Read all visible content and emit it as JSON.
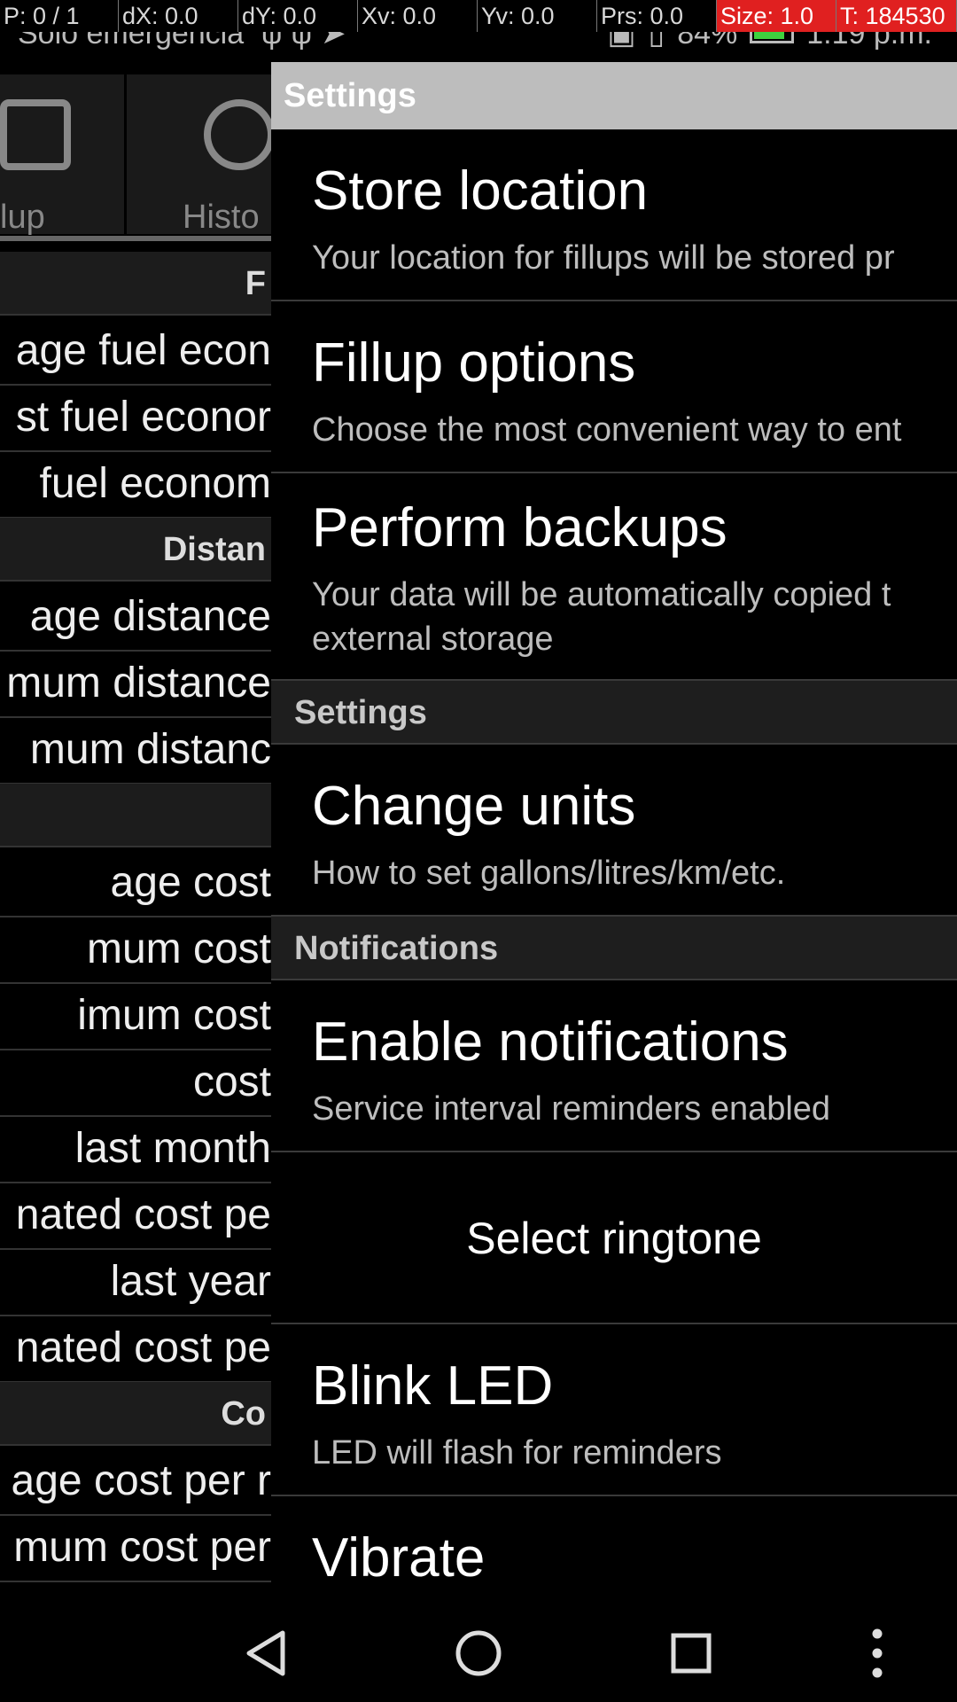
{
  "debug_bar": {
    "cells": [
      "P: 0 / 1",
      "dX: 0.0",
      "dY: 0.0",
      "Xv: 0.0",
      "Yv: 0.0",
      "Prs: 0.0",
      "Size: 1.0",
      "T: 184530"
    ]
  },
  "status_bar": {
    "carrier": "Solo emergencia",
    "battery": "84%",
    "battery_level": 0.84,
    "time": "1:19 p.m."
  },
  "background_app": {
    "tabs": [
      {
        "label": "lup",
        "icon": "fuel-pump-icon"
      },
      {
        "label": "Histo",
        "icon": "clock-icon"
      }
    ],
    "rows": [
      {
        "text": "F",
        "header": true
      },
      {
        "text": "age fuel econ"
      },
      {
        "text": "st fuel econor"
      },
      {
        "text": " fuel econom"
      },
      {
        "text": "Distan",
        "header": true
      },
      {
        "text": "age distance "
      },
      {
        "text": "mum distance"
      },
      {
        "text": "mum distanc"
      },
      {
        "text": "",
        "header": true
      },
      {
        "text": "age cost"
      },
      {
        "text": "mum cost"
      },
      {
        "text": "imum cost"
      },
      {
        "text": " cost"
      },
      {
        "text": " last month"
      },
      {
        "text": "nated cost pe"
      },
      {
        "text": " last year"
      },
      {
        "text": "nated cost pe"
      },
      {
        "text": "Co",
        "header": true
      },
      {
        "text": "age cost per r"
      },
      {
        "text": "mum cost per"
      }
    ]
  },
  "drawer": {
    "title": "Settings",
    "store_location": {
      "title": "Store location",
      "summary": "Your location for fillups will be stored pr"
    },
    "fillup_options": {
      "title": "Fillup options",
      "summary": "Choose the most convenient way to ent"
    },
    "perform_backups": {
      "title": "Perform backups",
      "summary": "Your data will be automatically copied t external storage"
    },
    "category_settings": "Settings",
    "change_units": {
      "title": "Change units",
      "summary": "How to set gallons/litres/km/etc."
    },
    "category_notifications": "Notifications",
    "enable_notifications": {
      "title": "Enable notifications",
      "summary": "Service interval reminders enabled"
    },
    "select_ringtone": "Select ringtone",
    "blink_led": {
      "title": "Blink LED",
      "summary": "LED will flash for reminders"
    },
    "vibrate": {
      "title": "Vibrate"
    }
  },
  "nav_bar": {
    "buttons": [
      "back-icon",
      "home-icon",
      "recents-icon",
      "overflow-menu-icon"
    ]
  }
}
